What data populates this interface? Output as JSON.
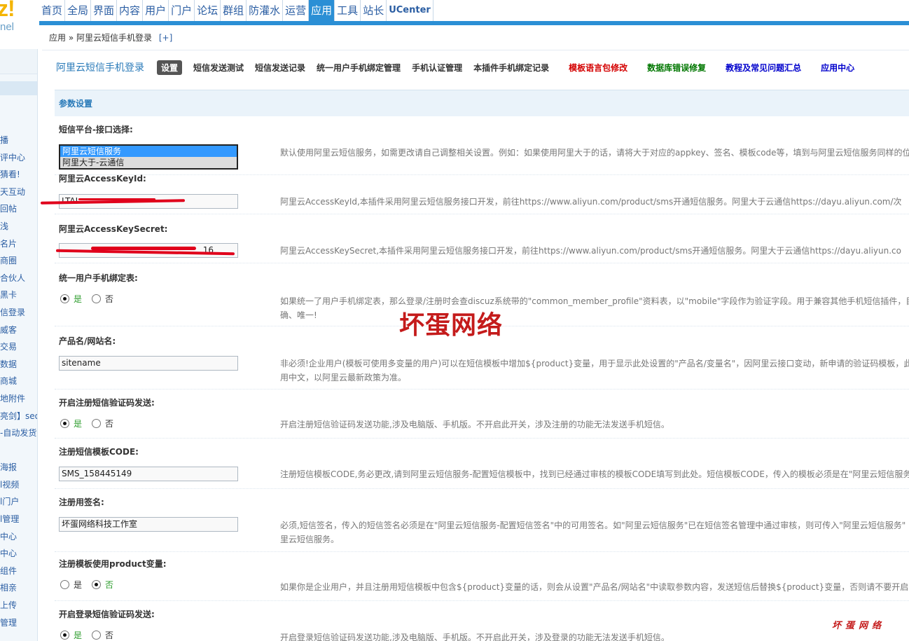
{
  "logo": {
    "text": "z!",
    "subtext": "nel"
  },
  "topnav": {
    "items": [
      "首页",
      "全局",
      "界面",
      "内容",
      "用户",
      "门户",
      "论坛",
      "群组",
      "防灌水",
      "运营",
      "应用",
      "工具",
      "站长",
      "UCenter"
    ],
    "active_index": 10
  },
  "sidebar": {
    "items": [
      "播",
      "评中心",
      "猜看!",
      "天互动",
      "回帖",
      "浅",
      "名片",
      "商圈",
      "合伙人",
      "黑卡",
      "信登录",
      "威客",
      "交易",
      "数据",
      "商城",
      "地附件",
      "亮剑】seo",
      "-自动发货",
      "",
      "海报",
      "l视频",
      "l门户",
      "l管理",
      "中心",
      "中心",
      "组件",
      "相亲",
      "上传",
      "管理"
    ]
  },
  "breadcrumb": {
    "root": "应用",
    "separator": "»",
    "current": "阿里云短信手机登录",
    "add": "[+]"
  },
  "tabs": {
    "plugin_title": "阿里云短信手机登录",
    "current": "设置",
    "items": [
      "短信发送测试",
      "短信发送记录",
      "统一用户手机绑定管理",
      "手机认证管理",
      "本插件手机绑定记录"
    ],
    "red": "模板语言包修改",
    "green": "数据库错误修复",
    "blue1": "教程及常见问题汇总",
    "blue2": "应用中心"
  },
  "panel": {
    "title": "参数设置",
    "rows": {
      "platform": {
        "label": "短信平台-接口选择:",
        "options": [
          "阿里云短信服务",
          "阿里大于-云通信"
        ],
        "desc": "默认使用阿里云短信服务，如需更改请自己调整相关设置。例如：如果使用阿里大于的话，请将大于对应的appkey、签名、模板code等，填到与阿里云短信服务同样的位"
      },
      "keyid": {
        "label": "阿里云AccessKeyId:",
        "value": "LTAI",
        "desc": "阿里云AccessKeyId,本插件采用阿里云短信服务接口开发，前往https://www.aliyun.com/product/sms开通短信服务。阿里大于云通信https://dayu.aliyun.com/次"
      },
      "secret": {
        "label": "阿里云AccessKeySecret:",
        "value": "16",
        "desc": "阿里云AccessKeySecret,本插件采用阿里云短信服务接口开发，前往https://www.aliyun.com/product/sms开通短信服务。阿里大于云通信https://dayu.aliyun.co"
      },
      "bind_table": {
        "label": "统一用户手机绑定表:",
        "yes": "是",
        "no": "否",
        "desc1": "如果统一了用户手机绑定表，那么登录/注册时会查discuz系统带的\"common_member_profile\"资料表，以\"mobile\"字段作为验证字段。用于兼容其他手机短信插件，目",
        "desc2": "确、唯一!"
      },
      "product": {
        "label": "产品名/网站名:",
        "value": "sitename",
        "desc1": "非必须!企业用户(模板可使用多变量的用户)可以在短信模板中增加${product}变量，用于显示此处设置的\"产品名/变量名\"，因阿里云接口变动，新申请的验证码模板，此",
        "desc2": "用中文，以阿里云最新政策为准。"
      },
      "reg_sms": {
        "label": "开启注册短信验证码发送:",
        "yes": "是",
        "no": "否",
        "desc": "开启注册短信验证码发送功能,涉及电脑版、手机版。不开启此开关，涉及注册的功能无法发送手机短信。"
      },
      "reg_code": {
        "label": "注册短信模板CODE:",
        "value": "SMS_158445149",
        "desc": "注册短信模板CODE,务必更改,请到阿里云短信服务-配置短信模板中，找到已经通过审核的模板CODE填写到此处。短信模板CODE，传入的模板必须是在\"阿里云短信服务"
      },
      "reg_sign": {
        "label": "注册用签名:",
        "value": "坏蛋网络科技工作室",
        "desc1": "必须,短信签名，传入的短信签名必须是在\"阿里云短信服务-配置短信签名\"中的可用签名。如\"阿里云短信服务\"已在短信签名管理中通过审核，则可传入\"阿里云短信服务\"",
        "desc2": "里云短信服务。"
      },
      "reg_product": {
        "label": "注册模板使用product变量:",
        "yes": "是",
        "no": "否",
        "desc": "如果你是企业用户，并且注册用短信模板中包含${product}变量的话，则会从设置\"产品名/网站名\"中读取参数内容，发送短信后替换${product}变量，否则请不要开启"
      },
      "login_sms": {
        "label": "开启登录短信验证码发送:",
        "yes": "是",
        "no": "否",
        "desc": "开启登录短信验证码发送功能,涉及电脑版、手机版。不开启此开关，涉及登录的功能无法发送手机短信。"
      }
    }
  },
  "watermark": {
    "main": "坏蛋网络",
    "small": "坏蛋网络"
  },
  "colors": {
    "accent": "#2b8fd5",
    "link": "#2b5ea3",
    "mask": "#e0001b"
  }
}
